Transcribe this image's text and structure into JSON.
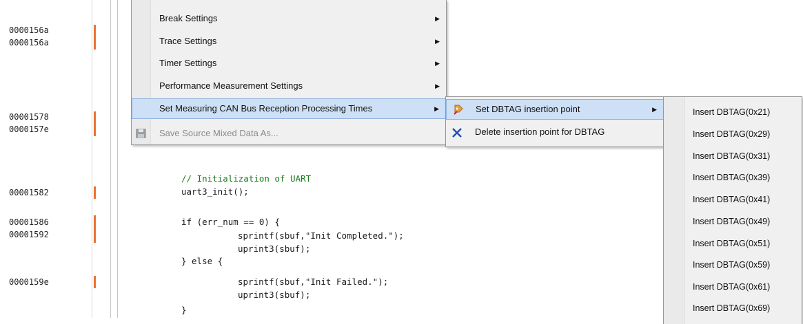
{
  "gutter": {
    "addresses": [
      "0000156a",
      "0000156a",
      "00001578",
      "0000157e",
      "00001582",
      "00001586",
      "00001592",
      "0000159e"
    ]
  },
  "code": {
    "lines": [
      "// Initialization of UART",
      "uart3_init();",
      "if (err_num == 0) {",
      "sprintf(sbuf,\"Init Completed.\");",
      "uprint3(sbuf);",
      "} else {",
      "sprintf(sbuf,\"Init Failed.\");",
      "uprint3(sbuf);",
      "}"
    ]
  },
  "context_menu": {
    "items": [
      {
        "label": "Break Settings",
        "submenu": true
      },
      {
        "label": "Trace Settings",
        "submenu": true
      },
      {
        "label": "Timer Settings",
        "submenu": true
      },
      {
        "label": "Performance Measurement Settings",
        "submenu": true
      },
      {
        "label": "Set Measuring CAN Bus Reception Processing Times",
        "submenu": true,
        "highlighted": true
      },
      {
        "label": "Save Source Mixed Data As...",
        "disabled": true,
        "icon": "floppy-disk-icon"
      }
    ]
  },
  "submenu_can": {
    "items": [
      {
        "label": "Set DBTAG insertion point",
        "submenu": true,
        "highlighted": true,
        "icon": "tag-pin-icon"
      },
      {
        "label": "Delete insertion point for DBTAG",
        "icon": "delete-x-icon"
      }
    ]
  },
  "submenu_dbtag": {
    "items": [
      "Insert DBTAG(0x21)",
      "Insert DBTAG(0x29)",
      "Insert DBTAG(0x31)",
      "Insert DBTAG(0x39)",
      "Insert DBTAG(0x41)",
      "Insert DBTAG(0x49)",
      "Insert DBTAG(0x51)",
      "Insert DBTAG(0x59)",
      "Insert DBTAG(0x61)",
      "Insert DBTAG(0x69)"
    ]
  },
  "colors": {
    "coverage_bar": "#f07030",
    "highlight_bg": "#cde0f5",
    "highlight_border": "#8fb2de"
  }
}
